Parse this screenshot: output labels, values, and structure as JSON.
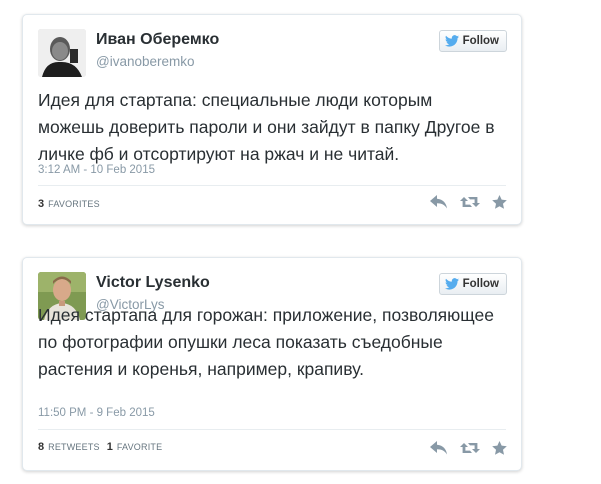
{
  "tweets": [
    {
      "author_name": "Иван Оберемко",
      "author_handle": "@ivanoberemko",
      "follow_label": "Follow",
      "text": "Идея для стартапа: специальные люди которым можешь доверить пароли и они зайдут в папку Другое в личке фб и отсортируют на ржач и не читай.",
      "timestamp": "3:12 AM - 10 Feb 2015",
      "stats": [
        {
          "count": "3",
          "label": "FAVORITES"
        }
      ],
      "icons": [
        "reply-icon",
        "retweet-icon",
        "favorite-icon"
      ]
    },
    {
      "author_name": "Victor Lysenko",
      "author_handle": "@VictorLys",
      "follow_label": "Follow",
      "text": "Идея стартапа для горожан: приложение, позволяющее по фотографии опушки леса показать съедобные растения и коренья, например, крапиву.",
      "timestamp": "11:50 PM - 9 Feb 2015",
      "stats": [
        {
          "count": "8",
          "label": "RETWEETS"
        },
        {
          "count": "1",
          "label": "FAVORITE"
        }
      ],
      "icons": [
        "reply-icon",
        "retweet-icon",
        "favorite-icon"
      ]
    }
  ],
  "colors": {
    "twitter_blue": "#55acee",
    "icon_gray": "#8899a6",
    "text": "#292f33",
    "muted": "#8899a6"
  }
}
